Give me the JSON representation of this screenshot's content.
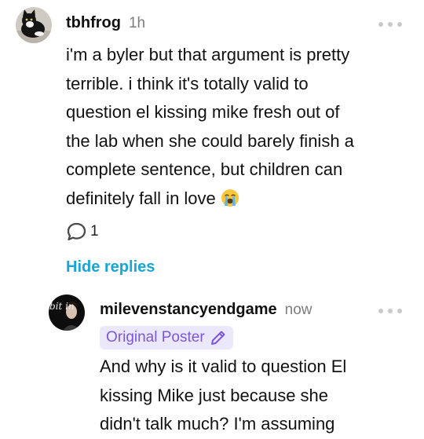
{
  "comments": [
    {
      "username": "tbhfrog",
      "timestamp": "1h",
      "lines": [
        "i'm a byler but that argument is pretty",
        "terrible. i think it's totally valid to",
        "question el kissing mike fresh out of",
        "the lab when she could barely finish a",
        "complete sentence, but children can",
        "definitely fall in love"
      ],
      "emoji": "loudly-crying-face",
      "reply_count": "1",
      "hide_replies_label": "Hide replies"
    },
    {
      "username": "milevenstancyendgame",
      "timestamp": "now",
      "badge_label": "Original Poster",
      "avatar_text": "bit in",
      "lines": [
        "And why is it valid to question El",
        "kissing Mike just because she",
        "didn't talk much? I'm assuming"
      ]
    }
  ],
  "icons": {
    "reply": "speech-bubble-icon",
    "more": "more-options-icon",
    "edit": "pencil-icon"
  },
  "colors": {
    "link": "#18a6d6",
    "badge_bg": "#ece8fb",
    "badge_text": "#7b57dc",
    "meta": "#7d7d7d"
  }
}
